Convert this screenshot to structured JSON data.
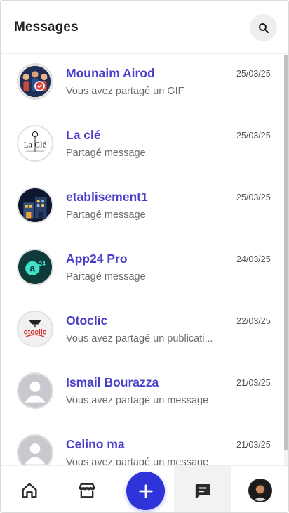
{
  "header": {
    "title": "Messages",
    "search_icon": "search-icon"
  },
  "conversations": [
    {
      "name": "Mounaim Airod",
      "preview": "Vous avez partagé un GIF",
      "date": "25/03/25",
      "avatar": "group-photo"
    },
    {
      "name": "La clé",
      "preview": "Partagé message",
      "date": "25/03/25",
      "avatar": "laclé-logo"
    },
    {
      "name": "etablisement1",
      "preview": "Partagé message",
      "date": "25/03/25",
      "avatar": "building-illustration"
    },
    {
      "name": "App24 Pro",
      "preview": "Partagé message",
      "date": "24/03/25",
      "avatar": "app24-logo"
    },
    {
      "name": "Otoclic",
      "preview": "Vous avez partagé un publicati...",
      "date": "22/03/25",
      "avatar": "otoclic-logo"
    },
    {
      "name": "Ismail Bourazza",
      "preview": "Vous avez partagé un message",
      "date": "21/03/25",
      "avatar": "default-user"
    },
    {
      "name": "Celino ma",
      "preview": "Vous avez partagé un message",
      "date": "21/03/25",
      "avatar": "default-user"
    }
  ],
  "avatar_logos": {
    "laclé": "La Clé",
    "app24": "a",
    "app24_sup": "24",
    "otoclic": "otoclic"
  },
  "bottom_nav": {
    "items": [
      "home-icon",
      "store-icon",
      "add-icon",
      "messages-icon",
      "profile-avatar"
    ],
    "active": "messages-icon"
  },
  "colors": {
    "accent": "#4a3fc9",
    "fab": "#2f34d9"
  }
}
